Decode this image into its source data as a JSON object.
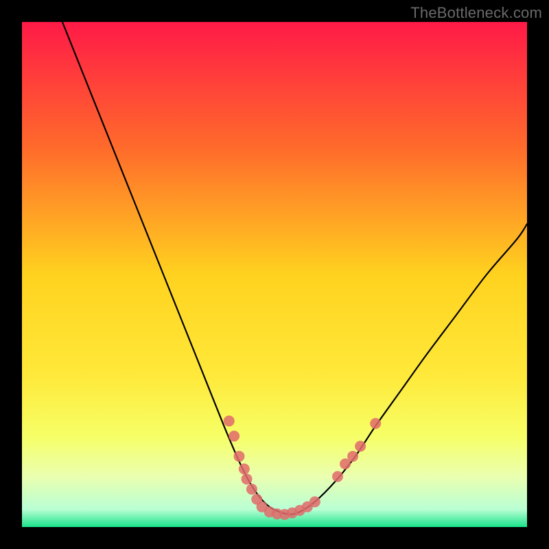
{
  "watermark": "TheBottleneck.com",
  "chart_data": {
    "type": "line",
    "title": "",
    "xlabel": "",
    "ylabel": "",
    "xlim": [
      0,
      100
    ],
    "ylim": [
      0,
      100
    ],
    "grid": false,
    "legend": false,
    "gradient_stops": [
      {
        "offset": 0.0,
        "color": "#ff1a47"
      },
      {
        "offset": 0.25,
        "color": "#ff6b2b"
      },
      {
        "offset": 0.5,
        "color": "#ffd21f"
      },
      {
        "offset": 0.7,
        "color": "#ffe93a"
      },
      {
        "offset": 0.82,
        "color": "#f6ff66"
      },
      {
        "offset": 0.9,
        "color": "#eaffb0"
      },
      {
        "offset": 0.965,
        "color": "#b9ffd4"
      },
      {
        "offset": 1.0,
        "color": "#19e38a"
      }
    ],
    "curve": {
      "name": "bottleneck-curve",
      "x": [
        8,
        12,
        16,
        20,
        24,
        28,
        32,
        36,
        40,
        43,
        45,
        47,
        49,
        51,
        53,
        55,
        58,
        62,
        66,
        70,
        75,
        80,
        86,
        92,
        98,
        100
      ],
      "y": [
        100,
        90,
        80,
        70,
        60,
        50,
        40,
        30,
        20,
        13,
        9,
        6,
        4,
        3,
        2.5,
        3,
        5,
        9,
        14,
        20,
        27,
        34,
        42,
        50,
        57,
        60
      ]
    },
    "scatter": {
      "name": "highlight-dots",
      "color": "#e06a6a",
      "radius": 8,
      "points": [
        {
          "x": 41.0,
          "y": 21.0
        },
        {
          "x": 42.0,
          "y": 18.0
        },
        {
          "x": 43.0,
          "y": 14.0
        },
        {
          "x": 44.0,
          "y": 11.5
        },
        {
          "x": 44.5,
          "y": 9.5
        },
        {
          "x": 45.5,
          "y": 7.5
        },
        {
          "x": 46.5,
          "y": 5.5
        },
        {
          "x": 47.5,
          "y": 4.0
        },
        {
          "x": 49.0,
          "y": 3.0
        },
        {
          "x": 50.5,
          "y": 2.6
        },
        {
          "x": 52.0,
          "y": 2.5
        },
        {
          "x": 53.5,
          "y": 2.8
        },
        {
          "x": 55.0,
          "y": 3.3
        },
        {
          "x": 56.5,
          "y": 4.0
        },
        {
          "x": 58.0,
          "y": 5.0
        },
        {
          "x": 62.5,
          "y": 10.0
        },
        {
          "x": 64.0,
          "y": 12.5
        },
        {
          "x": 65.5,
          "y": 14.0
        },
        {
          "x": 67.0,
          "y": 16.0
        },
        {
          "x": 70.0,
          "y": 20.5
        }
      ]
    }
  }
}
